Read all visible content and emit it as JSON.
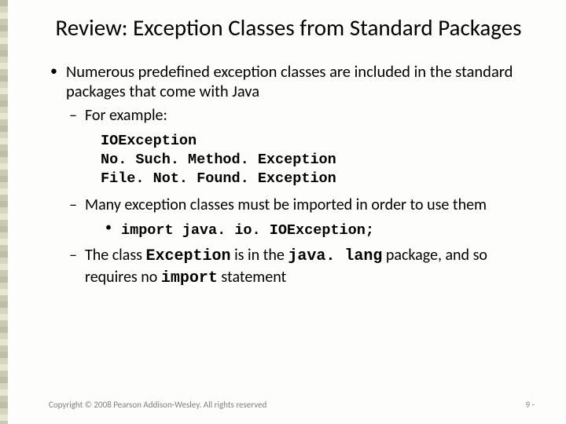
{
  "title": "Review: Exception Classes from Standard Packages",
  "bullet1": "Numerous predefined exception classes are included in the standard packages that come with Java",
  "sub1": "For example:",
  "code": {
    "l1": "IOException",
    "l2": "No. Such. Method. Exception",
    "l3": "File. Not. Found. Exception"
  },
  "sub2": "Many exception classes must be imported in order to use them",
  "import_line": "import java. io. IOException;",
  "sub3_a": "The class ",
  "sub3_b": "Exception",
  "sub3_c": " is in the ",
  "sub3_d": "java. lang",
  "sub3_e": " package, and so requires no ",
  "sub3_f": "import",
  "sub3_g": " statement",
  "copyright": "Copyright © 2008 Pearson Addison-Wesley. All rights reserved",
  "pagenum": "9 -"
}
